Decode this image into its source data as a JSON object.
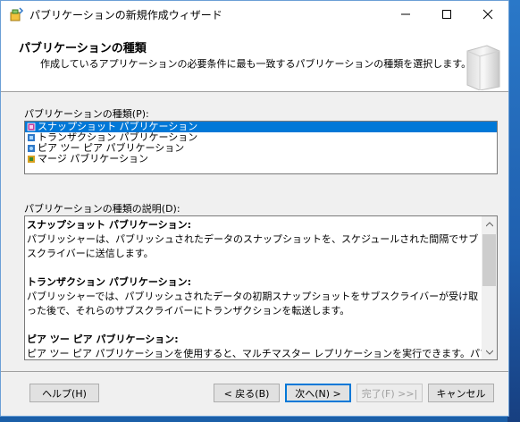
{
  "window": {
    "title": "パブリケーションの新規作成ウィザード",
    "controls": {
      "minimize": "─",
      "maximize": "☐",
      "close": "✕"
    }
  },
  "header": {
    "title": "パブリケーションの種類",
    "description": "作成しているアプリケーションの必要条件に最も一致するパブリケーションの種類を選択します。"
  },
  "type_list": {
    "label": "パブリケーションの種類(P):",
    "items": [
      {
        "label": "スナップショット パブリケーション",
        "selected": true,
        "icon_color": "#c040a0"
      },
      {
        "label": "トランザクション パブリケーション",
        "selected": false,
        "icon_color": "#2f78c8"
      },
      {
        "label": "ピア ツー ピア パブリケーション",
        "selected": false,
        "icon_color": "#2f78c8"
      },
      {
        "label": "マージ パブリケーション",
        "selected": false,
        "icon_color": "#d8a020"
      }
    ]
  },
  "description": {
    "label": "パブリケーションの種類の説明(D):",
    "sections": [
      {
        "heading": "スナップショット パブリケーション:",
        "text": "パブリッシャーは、パブリッシュされたデータのスナップショットを、スケジュールされた間隔でサブスクライバーに送信します。"
      },
      {
        "heading": "トランザクション パブリケーション:",
        "text": "パブリッシャーでは、パブリッシュされたデータの初期スナップショットをサブスクライバーが受け取った後で、それらのサブスクライバーにトランザクションを転送します。"
      },
      {
        "heading": "ピア ツー ピア パブリケーション:",
        "text": "ピア ツー ピア パブリケーションを使用すると、マルチマスター レプリケーションを実行できます。パブリッシャーは、ト"
      }
    ]
  },
  "buttons": {
    "help": "ヘルプ(H)",
    "back": "< 戻る(B)",
    "next": "次へ(N) >",
    "finish": "完了(F) >>|",
    "cancel": "キャンセル"
  }
}
